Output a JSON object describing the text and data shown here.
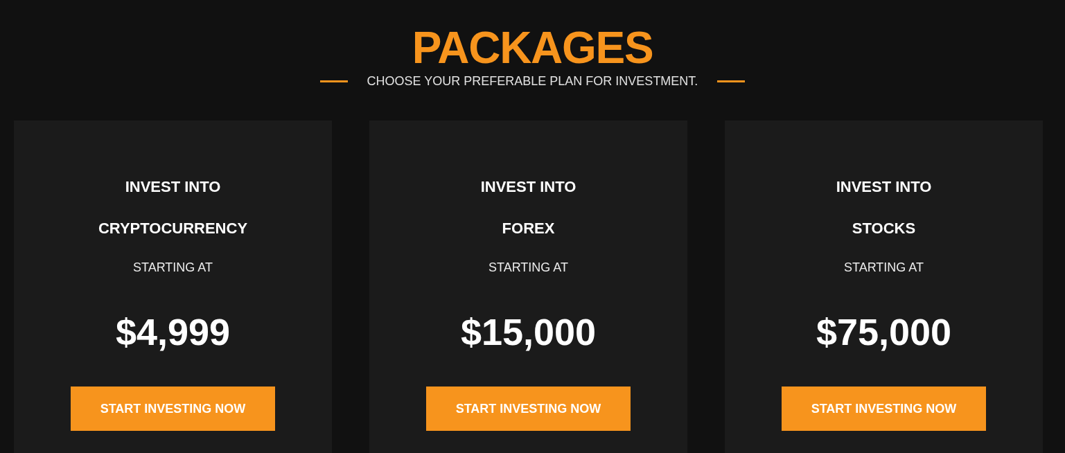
{
  "header": {
    "title": "PACKAGES",
    "subtitle": "CHOOSE YOUR PREFERABLE PLAN FOR INVESTMENT."
  },
  "packages": [
    {
      "heading": "INVEST INTO",
      "category": "CRYPTOCURRENCY",
      "price_label": "STARTING AT",
      "price": "$4,999",
      "button": "START INVESTING NOW"
    },
    {
      "heading": "INVEST INTO",
      "category": "FOREX",
      "price_label": "STARTING AT",
      "price": "$15,000",
      "button": "START INVESTING NOW"
    },
    {
      "heading": "INVEST INTO",
      "category": "STOCKS",
      "price_label": "STARTING AT",
      "price": "$75,000",
      "button": "START INVESTING NOW"
    }
  ]
}
